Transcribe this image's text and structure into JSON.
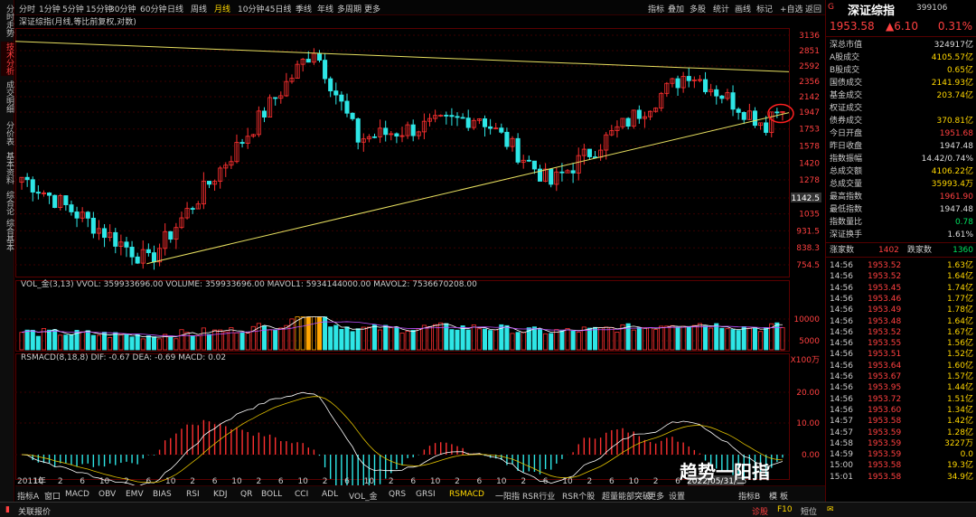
{
  "left_tabs": [
    "分时走势",
    "技术分析",
    "成交明细",
    "分价表",
    "基本资料",
    "综合论",
    "综合基本"
  ],
  "top_tabs": [
    "分时",
    "1分钟",
    "5分钟",
    "15分钟",
    "30分钟",
    "60分钟",
    "日线",
    "周线",
    "月线",
    "10分钟",
    "45日线",
    "季线",
    "年线",
    "多周期",
    "更多"
  ],
  "top_right": [
    "指标",
    "叠加",
    "多股",
    "统计",
    "画线",
    "标记",
    "+自选",
    "返回"
  ],
  "chart": {
    "title": "深证综指(月线,等比前复权,对数)",
    "price_ticks": [
      "3136",
      "2851",
      "2592",
      "2356",
      "2142",
      "1947",
      "1753",
      "1578",
      "1420",
      "1278",
      "1142.5",
      "1035",
      "931.5",
      "838.3",
      "754.5"
    ],
    "vol_label": "VOL_金(3,13) VVOL: 359933696.00 VOLUME: 359933696.00 MAVOL1: 5934144000.00 MAVOL2: 7536670208.00",
    "vol_ticks": [
      "10000",
      "5000",
      "X100万"
    ],
    "macd_label": "RSMACD(8,18,8) DIF: -0.67 DEA: -0.69 MACD: 0.02",
    "macd_ticks": [
      "20.00",
      "10.00",
      "0.00"
    ],
    "x_ticks": [
      "2011年",
      "10",
      "2",
      "6",
      "10",
      "2",
      "6",
      "10",
      "2",
      "6",
      "10",
      "2",
      "6",
      "10",
      "2",
      "6",
      "10",
      "2",
      "6",
      "10",
      "2",
      "6",
      "10",
      "2",
      "6",
      "10",
      "2",
      "6",
      "10",
      "2",
      "6",
      "10",
      "2",
      "6"
    ],
    "date_box": "2022/05/31/二"
  },
  "bottom_tabs": [
    "指标A",
    "窗口",
    "MACD",
    "OBV",
    "EMV",
    "BIAS",
    "RSI",
    "KDJ",
    "QR",
    "BOLL",
    "CCI",
    "ADL",
    "VOL_金",
    "QRS",
    "GRSI",
    "RSMACD",
    "一阳指",
    "RSR行业",
    "RSR个股",
    "超量能部突破",
    "更多",
    "设置"
  ],
  "bottom_right": [
    "指标B",
    "模",
    "板"
  ],
  "info": {
    "badge": "G",
    "name": "深证综指",
    "code": "399106",
    "price": "1953.58",
    "change": "▲6.10",
    "pct": "0.31%",
    "rows": [
      {
        "k": "深总市值",
        "v": "324917亿",
        "c": "#dddddd"
      },
      {
        "k": "A股成交",
        "v": "4105.57亿",
        "c": "#ffd700"
      },
      {
        "k": "B股成交",
        "v": "0.65亿",
        "c": "#ffd700"
      },
      {
        "k": "国债成交",
        "v": "2141.93亿",
        "c": "#ffd700"
      },
      {
        "k": "基金成交",
        "v": "203.74亿",
        "c": "#ffd700"
      },
      {
        "k": "权证成交",
        "v": "",
        "c": "#ffd700"
      },
      {
        "k": "债券成交",
        "v": "370.81亿",
        "c": "#ffd700"
      },
      {
        "k": "今日开盘",
        "v": "1951.68",
        "c": "#ff4040"
      },
      {
        "k": "昨日收盘",
        "v": "1947.48",
        "c": "#dddddd"
      },
      {
        "k": "指数振幅",
        "v": "14.42/0.74%",
        "c": "#dddddd"
      },
      {
        "k": "总成交额",
        "v": "4106.22亿",
        "c": "#ffd700"
      },
      {
        "k": "总成交量",
        "v": "35993.4万",
        "c": "#ffd700"
      },
      {
        "k": "最高指数",
        "v": "1961.90",
        "c": "#ff4040"
      },
      {
        "k": "最低指数",
        "v": "1947.48",
        "c": "#dddddd"
      },
      {
        "k": "指数量比",
        "v": "0.78",
        "c": "#00e060"
      },
      {
        "k": "深证换手",
        "v": "1.61%",
        "c": "#dddddd"
      }
    ],
    "rise_label": "涨家数",
    "rise": "1402",
    "fall_label": "跌家数",
    "fall": "1360",
    "ticks": [
      {
        "t": "14:56",
        "p": "1953.52",
        "a": "1.63亿"
      },
      {
        "t": "14:56",
        "p": "1953.52",
        "a": "1.64亿"
      },
      {
        "t": "14:56",
        "p": "1953.45",
        "a": "1.74亿"
      },
      {
        "t": "14:56",
        "p": "1953.46",
        "a": "1.77亿"
      },
      {
        "t": "14:56",
        "p": "1953.49",
        "p2": "",
        "a": "1.78亿"
      },
      {
        "t": "14:56",
        "p": "1953.48",
        "a": "1.64亿"
      },
      {
        "t": "14:56",
        "p": "1953.52",
        "a": "1.67亿"
      },
      {
        "t": "14:56",
        "p": "1953.55",
        "a": "1.56亿"
      },
      {
        "t": "14:56",
        "p": "1953.51",
        "a": "1.52亿"
      },
      {
        "t": "14:56",
        "p": "1953.64",
        "a": "1.60亿"
      },
      {
        "t": "14:56",
        "p": "1953.67",
        "a": "1.57亿"
      },
      {
        "t": "14:56",
        "p": "1953.95",
        "a": "1.44亿"
      },
      {
        "t": "14:56",
        "p": "1953.72",
        "a": "1.51亿"
      },
      {
        "t": "14:56",
        "p": "1953.60",
        "a": "1.34亿"
      },
      {
        "t": "14:57",
        "p": "1953.58",
        "a": "1.42亿"
      },
      {
        "t": "14:57",
        "p": "1953.59",
        "a": "1.28亿"
      },
      {
        "t": "14:58",
        "p": "1953.59",
        "a": "3227万"
      },
      {
        "t": "14:59",
        "p": "1953.59",
        "a": "0.0"
      },
      {
        "t": "15:00",
        "p": "1953.58",
        "a": "19.3亿"
      },
      {
        "t": "15:01",
        "p": "1953.58",
        "a": "34.9亿"
      }
    ]
  },
  "status": {
    "left": "关联报价",
    "right1": "诊股",
    "right2": "F10",
    "right3": "短位"
  },
  "watermark": "趋势一阳指",
  "colors": {
    "up": "#ff3030",
    "down": "#2ee6e6",
    "ma1": "#ffffff",
    "ma2": "#e0c000",
    "trend": "#e8e060"
  },
  "chart_data": {
    "type": "candlestick",
    "scale": "log",
    "ylim": [
      754.5,
      3136
    ],
    "start": "2011-01",
    "periods": 139,
    "key_points": [
      {
        "date": "2011-01",
        "price": 1300
      },
      {
        "date": "2012-12",
        "price": 770
      },
      {
        "date": "2015-06",
        "price": 2900
      },
      {
        "date": "2016-02",
        "price": 1650
      },
      {
        "date": "2017-12",
        "price": 1900
      },
      {
        "date": "2019-01",
        "price": 1250
      },
      {
        "date": "2021-02",
        "price": 2500
      },
      {
        "date": "2022-04",
        "price": 1800
      },
      {
        "date": "2022-05",
        "price": 1953.58
      }
    ]
  }
}
